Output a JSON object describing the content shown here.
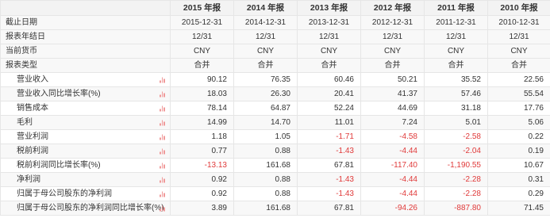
{
  "columns": [
    "2015 年报",
    "2014 年报",
    "2013 年报",
    "2012 年报",
    "2011 年报",
    "2010 年报"
  ],
  "meta_rows": [
    {
      "label": "截止日期",
      "values": [
        "2015-12-31",
        "2014-12-31",
        "2013-12-31",
        "2012-12-31",
        "2011-12-31",
        "2010-12-31"
      ]
    },
    {
      "label": "报表年结日",
      "values": [
        "12/31",
        "12/31",
        "12/31",
        "12/31",
        "12/31",
        "12/31"
      ]
    },
    {
      "label": "当前货币",
      "values": [
        "CNY",
        "CNY",
        "CNY",
        "CNY",
        "CNY",
        "CNY"
      ]
    },
    {
      "label": "报表类型",
      "values": [
        "合并",
        "合并",
        "合并",
        "合并",
        "合并",
        "合并"
      ]
    }
  ],
  "data_rows": [
    {
      "label": "营业收入",
      "values": [
        "90.12",
        "76.35",
        "60.46",
        "50.21",
        "35.52",
        "22.56"
      ]
    },
    {
      "label": "营业收入同比增长率(%)",
      "values": [
        "18.03",
        "26.30",
        "20.41",
        "41.37",
        "57.46",
        "55.54"
      ]
    },
    {
      "label": "销售成本",
      "values": [
        "78.14",
        "64.87",
        "52.24",
        "44.69",
        "31.18",
        "17.76"
      ]
    },
    {
      "label": "毛利",
      "values": [
        "14.99",
        "14.70",
        "11.01",
        "7.24",
        "5.01",
        "5.06"
      ]
    },
    {
      "label": "营业利润",
      "values": [
        "1.18",
        "1.05",
        "-1.71",
        "-4.58",
        "-2.58",
        "0.22"
      ]
    },
    {
      "label": "税前利润",
      "values": [
        "0.77",
        "0.88",
        "-1.43",
        "-4.44",
        "-2.04",
        "0.19"
      ]
    },
    {
      "label": "税前利润同比增长率(%)",
      "values": [
        "-13.13",
        "161.68",
        "67.81",
        "-117.40",
        "-1,190.55",
        "10.67"
      ]
    },
    {
      "label": "净利润",
      "values": [
        "0.92",
        "0.88",
        "-1.43",
        "-4.44",
        "-2.28",
        "0.31"
      ]
    },
    {
      "label": "归属于母公司股东的净利润",
      "values": [
        "0.92",
        "0.88",
        "-1.43",
        "-4.44",
        "-2.28",
        "0.29"
      ]
    },
    {
      "label": "归属于母公司股东的净利润同比增长率(%)",
      "values": [
        "3.89",
        "161.68",
        "67.81",
        "-94.26",
        "-887.80",
        "71.45"
      ]
    }
  ],
  "colors": {
    "negative": "#e03a3a",
    "chart_icon": "#f09a9a",
    "header_bg": "#f3f3f3"
  },
  "icon": "bar-chart-icon"
}
